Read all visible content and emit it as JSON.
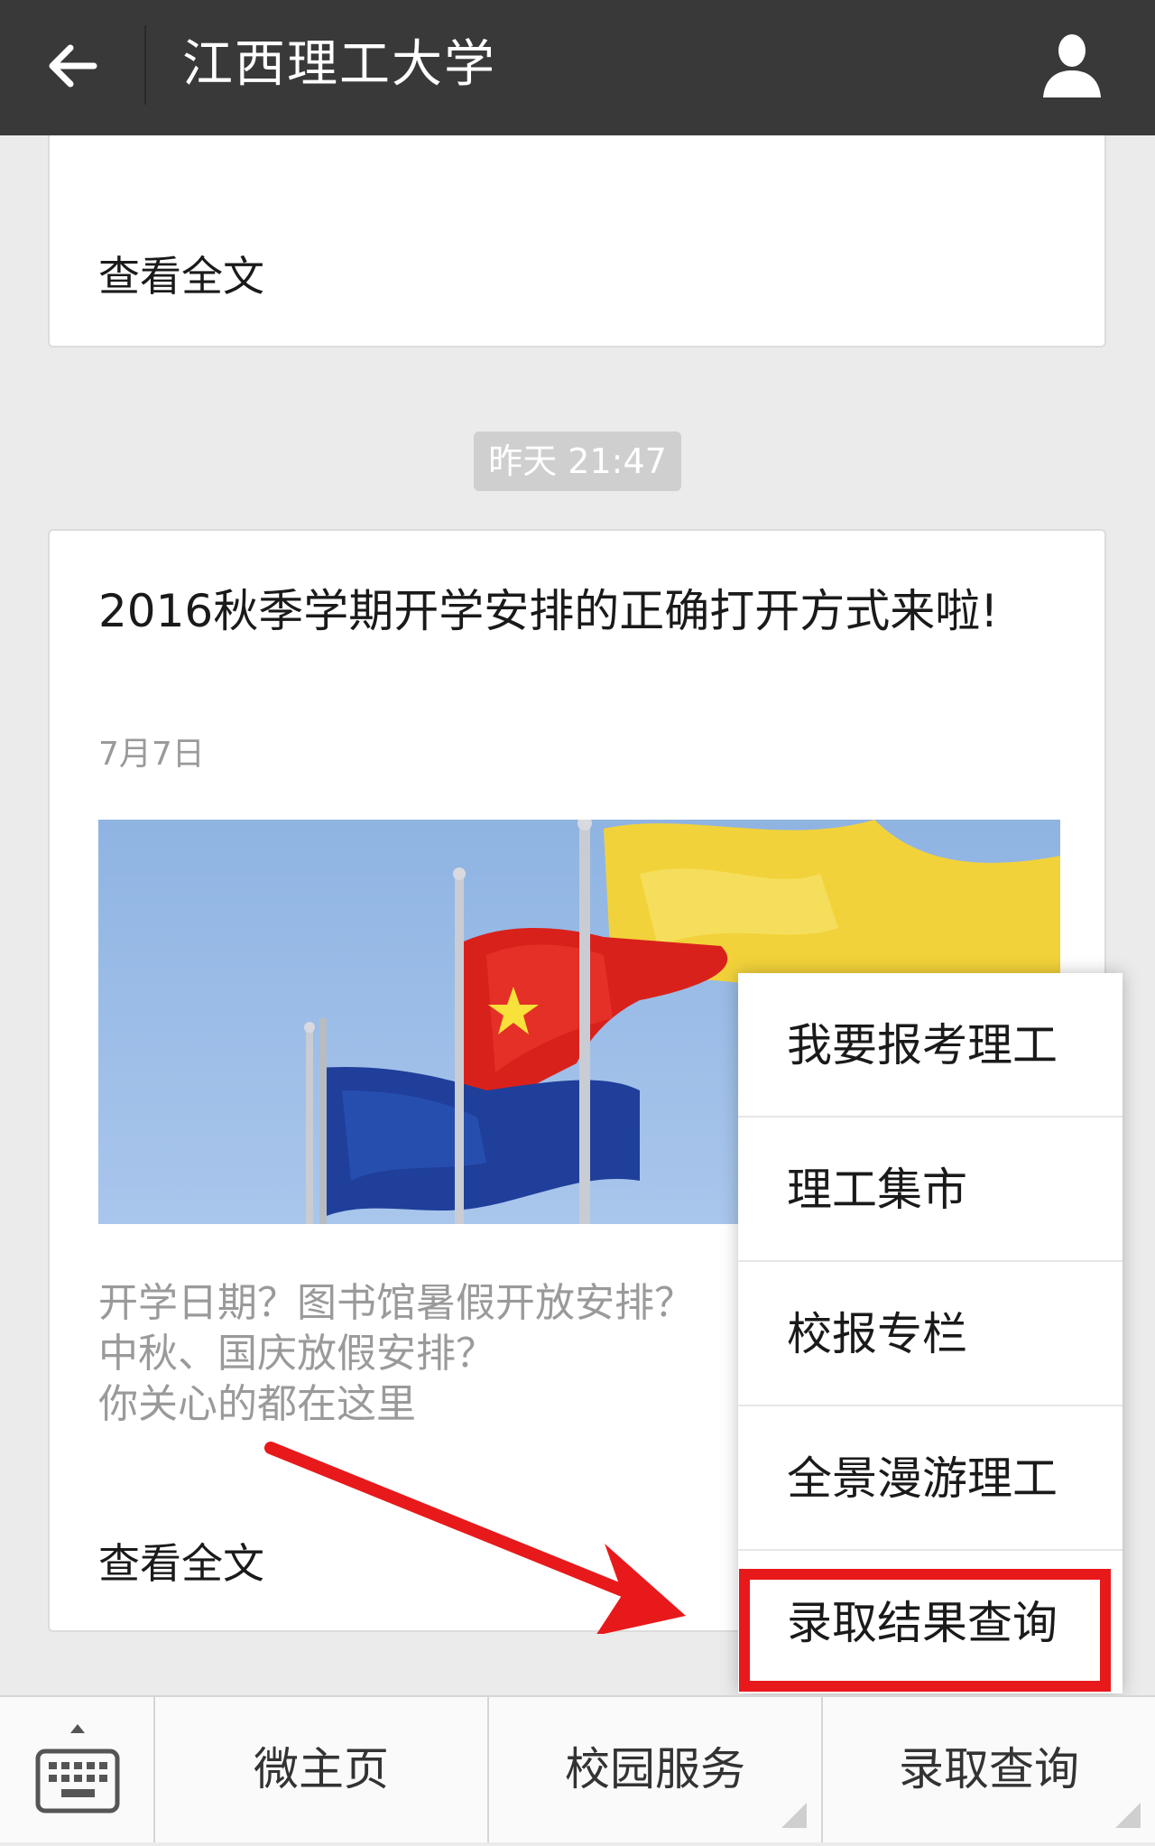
{
  "header": {
    "title": "江西理工大学",
    "back_icon": "arrow-left-icon",
    "profile_icon": "person-icon"
  },
  "previous_card": {
    "read_more": "查看全文"
  },
  "timestamp": "昨天 21:47",
  "article": {
    "title": "2016秋季学期开学安排的正确打开方式来啦!",
    "date": "7月7日",
    "image_icon": "flags-image",
    "summary_lines": [
      "开学日期？图书馆暑假开放安排？",
      "中秋、国庆放假安排？",
      "你关心的都在这里"
    ],
    "read_more": "查看全文"
  },
  "popup_menu": {
    "items": [
      "我要报考理工",
      "理工集市",
      "校报专栏",
      "全景漫游理工",
      "录取结果查询"
    ],
    "highlight_color": "#e8191b"
  },
  "bottom_bar": {
    "keyboard_icon": "keyboard-icon",
    "tabs": [
      "微主页",
      "校园服务",
      "录取查询"
    ]
  }
}
